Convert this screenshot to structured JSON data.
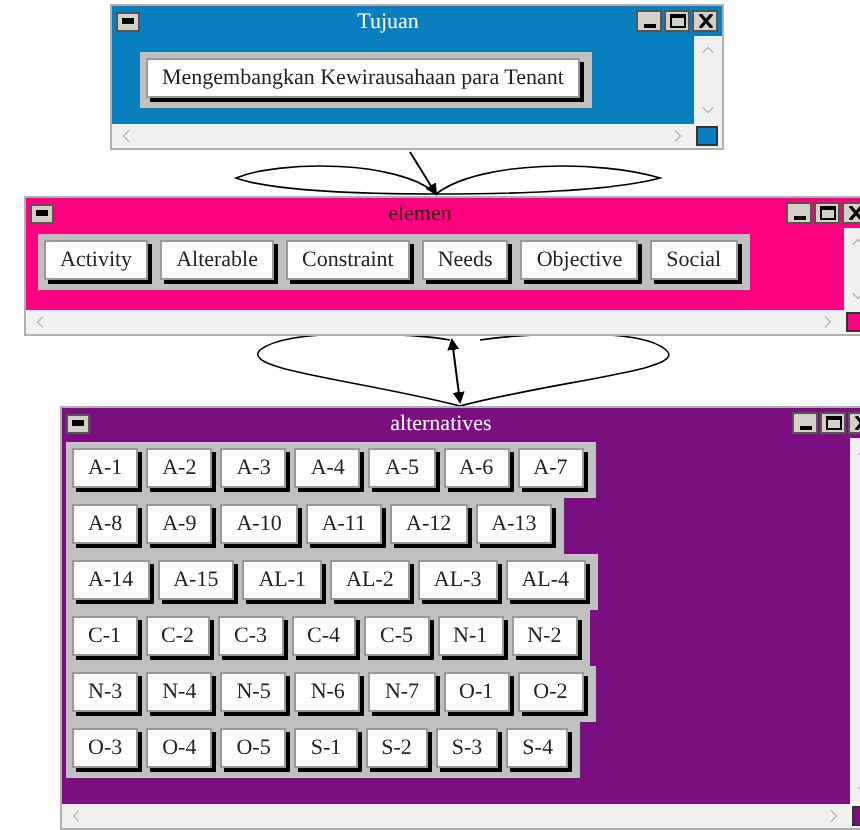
{
  "windows": [
    {
      "title": "Tujuan",
      "color": "#0a7fc0",
      "rows": [
        [
          "Mengembangkan Kewirausahaan para Tenant"
        ]
      ]
    },
    {
      "title": "elemen",
      "color": "#ff0080",
      "rows": [
        [
          "Activity",
          "Alterable",
          "Constraint",
          "Needs",
          "Objective",
          "Social"
        ]
      ]
    },
    {
      "title": "alternatives",
      "color": "#7b0f80",
      "rows": [
        [
          "A-1",
          "A-2",
          "A-3",
          "A-4",
          "A-5",
          "A-6",
          "A-7"
        ],
        [
          "A-8",
          "A-9",
          "A-10",
          "A-11",
          "A-12",
          "A-13"
        ],
        [
          "A-14",
          "A-15",
          "AL-1",
          "AL-2",
          "AL-3",
          "AL-4"
        ],
        [
          "C-1",
          "C-2",
          "C-3",
          "C-4",
          "C-5",
          "N-1",
          "N-2"
        ],
        [
          "N-3",
          "N-4",
          "N-5",
          "N-6",
          "N-7",
          "O-1",
          "O-2"
        ],
        [
          "O-3",
          "O-4",
          "O-5",
          "S-1",
          "S-2",
          "S-3",
          "S-4"
        ]
      ]
    }
  ]
}
